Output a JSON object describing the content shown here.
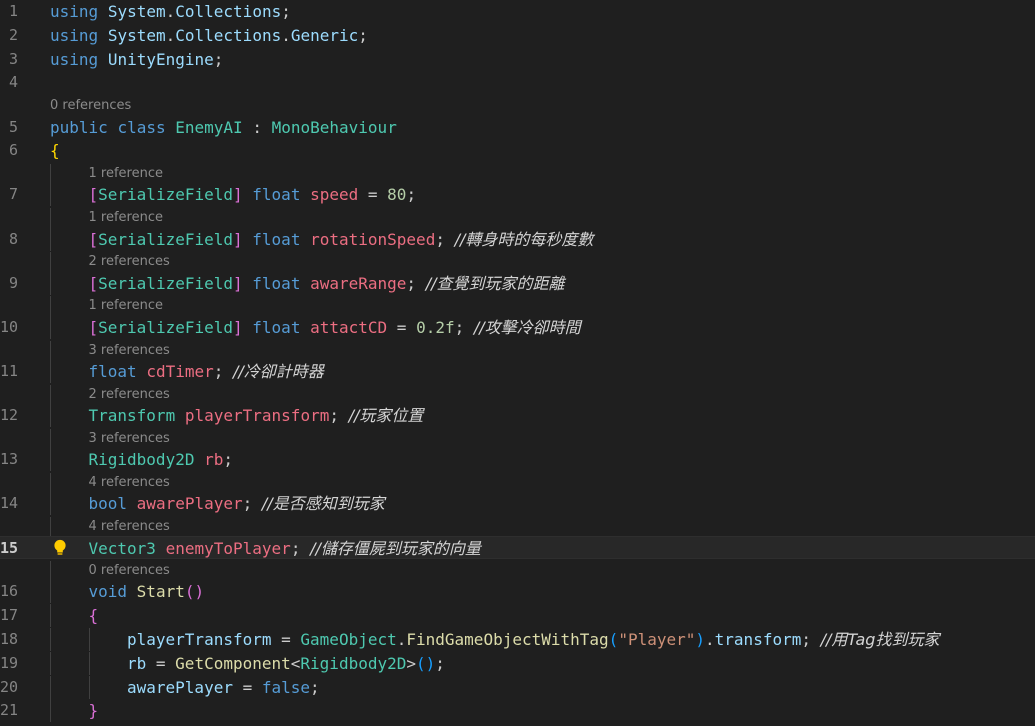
{
  "editor": {
    "language": "csharp",
    "active_line": "15",
    "lines": [
      {
        "n": "1",
        "parts": [
          {
            "t": "using",
            "c": "kw"
          },
          {
            "t": " "
          },
          {
            "t": "System",
            "c": "cls2"
          },
          {
            "t": "."
          },
          {
            "t": "Collections",
            "c": "cls2"
          },
          {
            "t": ";"
          }
        ]
      },
      {
        "n": "2",
        "parts": [
          {
            "t": "using",
            "c": "kw"
          },
          {
            "t": " "
          },
          {
            "t": "System",
            "c": "cls2"
          },
          {
            "t": "."
          },
          {
            "t": "Collections",
            "c": "cls2"
          },
          {
            "t": "."
          },
          {
            "t": "Generic",
            "c": "cls2"
          },
          {
            "t": ";"
          }
        ]
      },
      {
        "n": "3",
        "parts": [
          {
            "t": "using",
            "c": "kw"
          },
          {
            "t": " "
          },
          {
            "t": "UnityEngine",
            "c": "cls2"
          },
          {
            "t": ";"
          }
        ]
      },
      {
        "n": "4",
        "parts": []
      },
      {
        "lens": "0 references",
        "indent": 0
      },
      {
        "n": "5",
        "parts": [
          {
            "t": "public",
            "c": "kw"
          },
          {
            "t": " "
          },
          {
            "t": "class",
            "c": "kw"
          },
          {
            "t": " "
          },
          {
            "t": "EnemyAI",
            "c": "ty"
          },
          {
            "t": " : "
          },
          {
            "t": "MonoBehaviour",
            "c": "ty"
          }
        ]
      },
      {
        "n": "6",
        "parts": [
          {
            "t": "{",
            "c": "br1"
          }
        ]
      },
      {
        "lens": "1 reference",
        "indent": 1
      },
      {
        "n": "7",
        "indent": 1,
        "parts": [
          {
            "t": "[",
            "c": "br2"
          },
          {
            "t": "SerializeField",
            "c": "ty"
          },
          {
            "t": "]",
            "c": "br2"
          },
          {
            "t": " "
          },
          {
            "t": "float",
            "c": "kw"
          },
          {
            "t": " "
          },
          {
            "t": "speed",
            "c": "fld"
          },
          {
            "t": " = "
          },
          {
            "t": "80",
            "c": "num"
          },
          {
            "t": ";"
          }
        ]
      },
      {
        "lens": "1 reference",
        "indent": 1
      },
      {
        "n": "8",
        "indent": 1,
        "parts": [
          {
            "t": "[",
            "c": "br2"
          },
          {
            "t": "SerializeField",
            "c": "ty"
          },
          {
            "t": "]",
            "c": "br2"
          },
          {
            "t": " "
          },
          {
            "t": "float",
            "c": "kw"
          },
          {
            "t": " "
          },
          {
            "t": "rotationSpeed",
            "c": "fld"
          },
          {
            "t": "; "
          },
          {
            "t": "//轉身時的每秒度數",
            "c": "cm"
          }
        ]
      },
      {
        "lens": "2 references",
        "indent": 1
      },
      {
        "n": "9",
        "indent": 1,
        "parts": [
          {
            "t": "[",
            "c": "br2"
          },
          {
            "t": "SerializeField",
            "c": "ty"
          },
          {
            "t": "]",
            "c": "br2"
          },
          {
            "t": " "
          },
          {
            "t": "float",
            "c": "kw"
          },
          {
            "t": " "
          },
          {
            "t": "awareRange",
            "c": "fld"
          },
          {
            "t": "; "
          },
          {
            "t": "//查覺到玩家的距離",
            "c": "cm"
          }
        ]
      },
      {
        "lens": "1 reference",
        "indent": 1
      },
      {
        "n": "10",
        "indent": 1,
        "parts": [
          {
            "t": "[",
            "c": "br2"
          },
          {
            "t": "SerializeField",
            "c": "ty"
          },
          {
            "t": "]",
            "c": "br2"
          },
          {
            "t": " "
          },
          {
            "t": "float",
            "c": "kw"
          },
          {
            "t": " "
          },
          {
            "t": "attactCD",
            "c": "fld"
          },
          {
            "t": " = "
          },
          {
            "t": "0.2f",
            "c": "num"
          },
          {
            "t": "; "
          },
          {
            "t": "//攻擊冷卻時間",
            "c": "cm"
          }
        ]
      },
      {
        "lens": "3 references",
        "indent": 1
      },
      {
        "n": "11",
        "indent": 1,
        "parts": [
          {
            "t": "float",
            "c": "kw"
          },
          {
            "t": " "
          },
          {
            "t": "cdTimer",
            "c": "fld"
          },
          {
            "t": "; "
          },
          {
            "t": "//冷卻計時器",
            "c": "cm"
          }
        ]
      },
      {
        "lens": "2 references",
        "indent": 1
      },
      {
        "n": "12",
        "indent": 1,
        "parts": [
          {
            "t": "Transform",
            "c": "ty"
          },
          {
            "t": " "
          },
          {
            "t": "playerTransform",
            "c": "fld"
          },
          {
            "t": "; "
          },
          {
            "t": "//玩家位置",
            "c": "cm"
          }
        ]
      },
      {
        "lens": "3 references",
        "indent": 1
      },
      {
        "n": "13",
        "indent": 1,
        "parts": [
          {
            "t": "Rigidbody2D",
            "c": "ty"
          },
          {
            "t": " "
          },
          {
            "t": "rb",
            "c": "fld"
          },
          {
            "t": ";"
          }
        ]
      },
      {
        "lens": "4 references",
        "indent": 1
      },
      {
        "n": "14",
        "indent": 1,
        "parts": [
          {
            "t": "bool",
            "c": "kw"
          },
          {
            "t": " "
          },
          {
            "t": "awarePlayer",
            "c": "fld"
          },
          {
            "t": "; "
          },
          {
            "t": "//是否感知到玩家",
            "c": "cm"
          }
        ]
      },
      {
        "lens": "4 references",
        "indent": 1
      },
      {
        "n": "15",
        "indent": 1,
        "current": true,
        "bulb": true,
        "parts": [
          {
            "t": "Vector3",
            "c": "ty"
          },
          {
            "t": " "
          },
          {
            "t": "enemyToPlayer",
            "c": "fld"
          },
          {
            "t": "; "
          },
          {
            "t": "//儲存僵屍到玩家的向量",
            "c": "cm"
          }
        ]
      },
      {
        "lens": "0 references",
        "indent": 1
      },
      {
        "n": "16",
        "indent": 1,
        "parts": [
          {
            "t": "void",
            "c": "kw"
          },
          {
            "t": " "
          },
          {
            "t": "Start",
            "c": "fn"
          },
          {
            "t": "()",
            "c": "br2"
          }
        ]
      },
      {
        "n": "17",
        "indent": 1,
        "parts": [
          {
            "t": "{",
            "c": "br2"
          }
        ]
      },
      {
        "n": "18",
        "indent": 2,
        "parts": [
          {
            "t": "playerTransform",
            "c": "tn"
          },
          {
            "t": " = "
          },
          {
            "t": "GameObject",
            "c": "ty"
          },
          {
            "t": "."
          },
          {
            "t": "FindGameObjectWithTag",
            "c": "fn"
          },
          {
            "t": "(",
            "c": "br3"
          },
          {
            "t": "\"Player\"",
            "c": "str"
          },
          {
            "t": ")",
            "c": "br3"
          },
          {
            "t": "."
          },
          {
            "t": "transform",
            "c": "tn"
          },
          {
            "t": "; "
          },
          {
            "t": "//用Tag找到玩家",
            "c": "cm"
          }
        ]
      },
      {
        "n": "19",
        "indent": 2,
        "parts": [
          {
            "t": "rb",
            "c": "tn"
          },
          {
            "t": " = "
          },
          {
            "t": "GetComponent",
            "c": "fn"
          },
          {
            "t": "<"
          },
          {
            "t": "Rigidbody2D",
            "c": "ty"
          },
          {
            "t": ">"
          },
          {
            "t": "()",
            "c": "br3"
          },
          {
            "t": ";"
          }
        ]
      },
      {
        "n": "20",
        "indent": 2,
        "parts": [
          {
            "t": "awarePlayer",
            "c": "tn"
          },
          {
            "t": " = "
          },
          {
            "t": "false",
            "c": "kw"
          },
          {
            "t": ";"
          }
        ]
      },
      {
        "n": "21",
        "indent": 1,
        "parts": [
          {
            "t": "}",
            "c": "br2"
          }
        ]
      }
    ]
  },
  "icons": {
    "lightbulb": "lightbulb-icon"
  },
  "colors": {
    "background": "#1f1f1f",
    "lightbulb": "#ffcc00"
  }
}
